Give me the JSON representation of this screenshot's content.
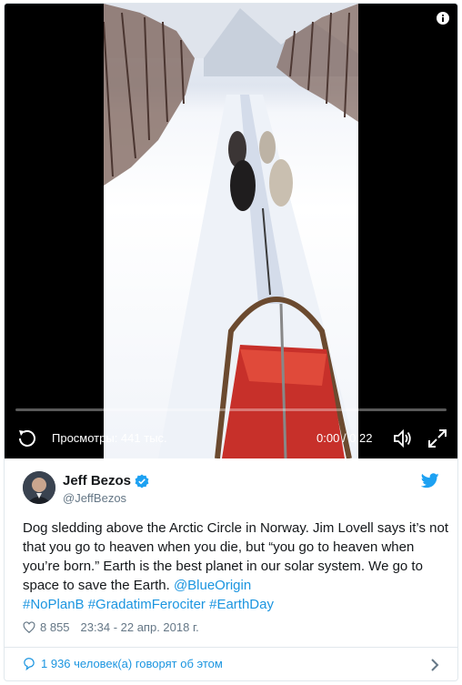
{
  "video": {
    "views": "Просмотры: 441 тыс.",
    "time": "0:00 / 0:22",
    "progress": 0,
    "icons": {
      "info": "info-icon",
      "replay": "replay-icon",
      "volume": "volume-icon",
      "fullscreen": "fullscreen-icon"
    }
  },
  "tweet": {
    "display_name": "Jeff Bezos",
    "handle": "@JeffBezos",
    "text_plain": "Dog sledding above the Arctic Circle in Norway. Jim Lovell says it’s not that you go to heaven when you die, but “you go to heaven when you’re born.” Earth is the best planet in our solar system. We go to space to save the Earth. ",
    "mention": "@BlueOrigin",
    "hashtags": [
      "#NoPlanB",
      "#GradatimFerociter",
      "#EarthDay"
    ],
    "likes": "8 855",
    "timestamp": "23:34 - 22 апр. 2018 г.",
    "conversation": "1 936 человек(а) говорят об этом"
  },
  "colors": {
    "link": "#1b95e0",
    "muted": "#657786",
    "verified": "#1da1f2",
    "border": "#e1e8ed"
  }
}
